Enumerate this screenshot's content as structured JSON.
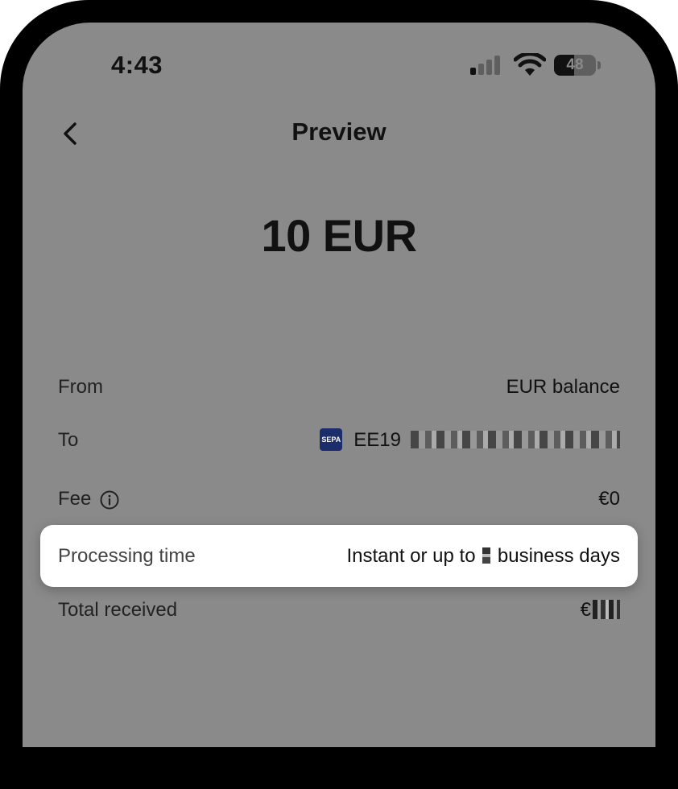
{
  "status_bar": {
    "time": "4:43",
    "battery": "48",
    "battery_level": 0.48,
    "signal_bars_active": 1,
    "icons": [
      "cellular-signal-icon",
      "wifi-icon",
      "battery-icon"
    ]
  },
  "header": {
    "back_icon": "chevron-left-icon",
    "title": "Preview"
  },
  "amount": "10 EUR",
  "details": {
    "from": {
      "label": "From",
      "value": "EUR balance"
    },
    "to": {
      "label": "To",
      "badge": "SEPA",
      "value": "EE19"
    },
    "fee": {
      "label": "Fee",
      "value": "€0",
      "icon": "info-icon"
    },
    "processing_time": {
      "label": "Processing time",
      "value_prefix": "Instant or up to",
      "value_suffix": "business days"
    },
    "total_received": {
      "label": "Total received",
      "value": "€"
    }
  },
  "colors": {
    "overlay": "#8a8a8a",
    "frame": "#000000",
    "card": "#ffffff",
    "sepa": "#1b2d6b"
  }
}
